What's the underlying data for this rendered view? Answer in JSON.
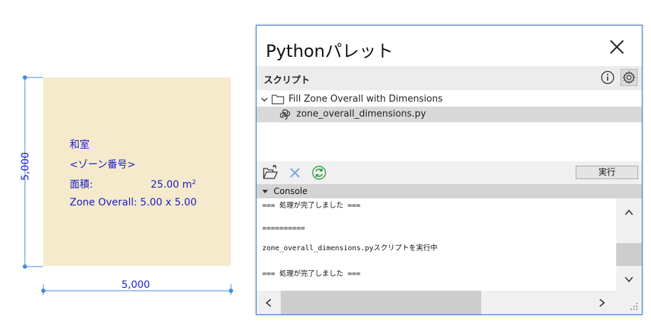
{
  "drawing": {
    "zone_name": "和室",
    "zone_number": "<ゾーン番号>",
    "area_label": "面積:",
    "area_value": "25.00 m",
    "area_unit_exp": "2",
    "zone_overall": "Zone Overall: 5.00 x 5.00",
    "dim_vertical": "5,000",
    "dim_horizontal": "5,000",
    "zone_color": "#f5ebcc",
    "text_color": "#1a1ac8"
  },
  "palette": {
    "title": "Pythonパレット",
    "section_label": "スクリプト",
    "tree": {
      "folder_name": "Fill Zone Overall with Dimensions",
      "script_name": "zone_overall_dimensions.py"
    },
    "run_button": "実行",
    "console_label": "Console",
    "console_lines": [
      "=== 処理が完了しました ===",
      "",
      "==========",
      "",
      "zone_overall_dimensions.pyスクリプトを実行中",
      "",
      "=== 処理が完了しました ==="
    ],
    "accent_color": "#3c7fd6",
    "refresh_color": "#2f9e44"
  }
}
